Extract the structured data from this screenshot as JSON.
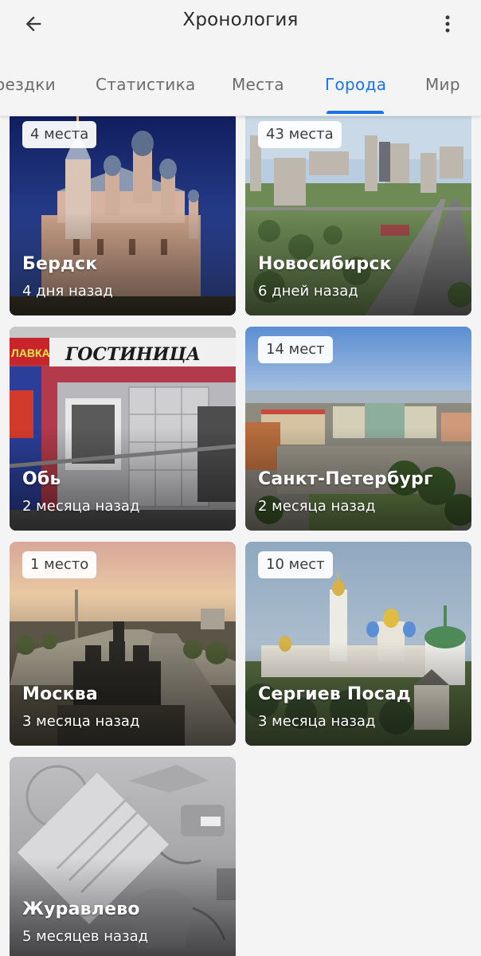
{
  "header": {
    "title": "Хронология"
  },
  "tabs": [
    {
      "label": "оездки",
      "active": false
    },
    {
      "label": "Статистика",
      "active": false
    },
    {
      "label": "Места",
      "active": false
    },
    {
      "label": "Города",
      "active": true
    },
    {
      "label": "Мир",
      "active": false
    }
  ],
  "colors": {
    "accent": "#1a73e8",
    "background": "#f4f4f4"
  },
  "cities": [
    {
      "badge": "4 места",
      "name": "Бердск",
      "ago": "4 дня назад"
    },
    {
      "badge": "43 места",
      "name": "Новосибирск",
      "ago": "6 дней назад"
    },
    {
      "badge": "",
      "name": "Обь",
      "ago": "2 месяца назад"
    },
    {
      "badge": "14 мест",
      "name": "Санкт-Петербург",
      "ago": "2 месяца назад"
    },
    {
      "badge": "1 место",
      "name": "Москва",
      "ago": "3 месяца назад"
    },
    {
      "badge": "10 мест",
      "name": "Сергиев Посад",
      "ago": "3 месяца назад"
    },
    {
      "badge": "",
      "name": "Журавлево",
      "ago": "5 месяцев назад"
    }
  ],
  "photo_signs": {
    "obi_hotel": "ГОСТИНИЦА",
    "obi_side": "ЛАВКА"
  }
}
